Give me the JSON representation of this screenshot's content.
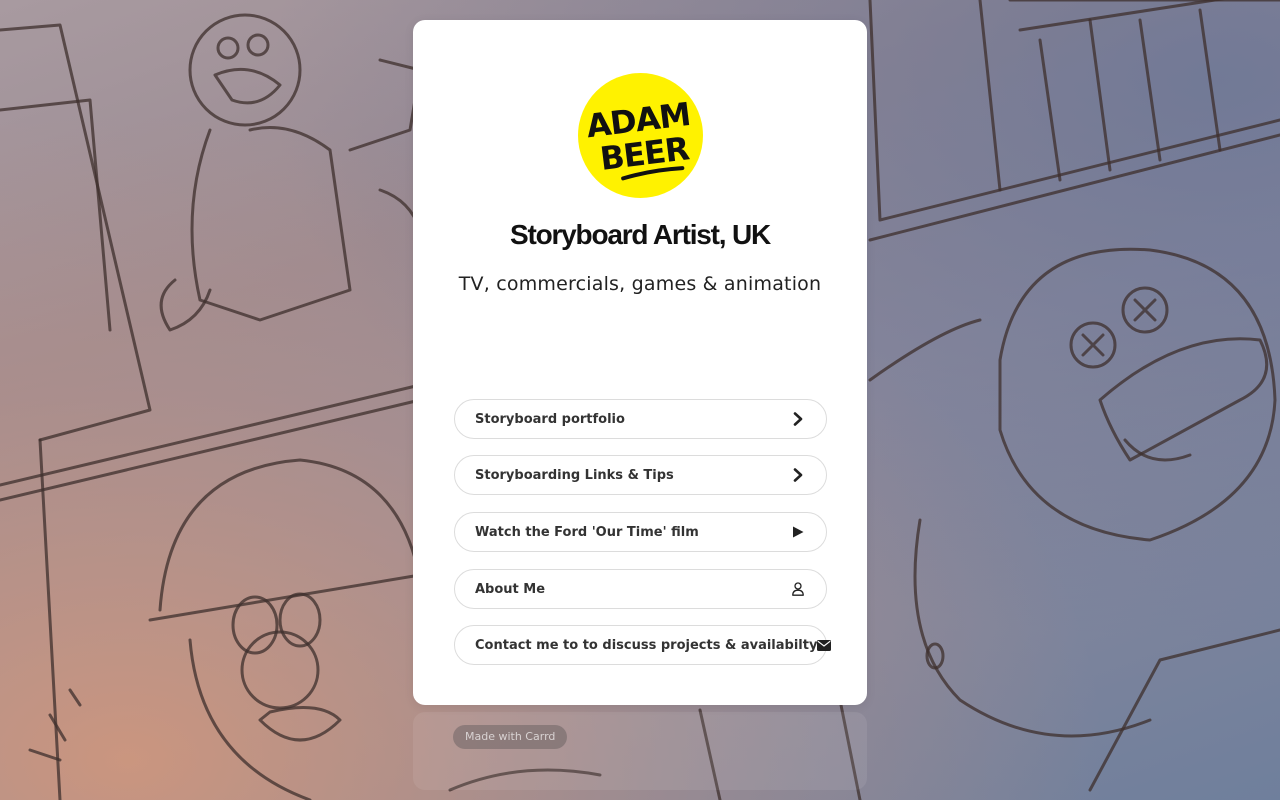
{
  "logo": {
    "line1": "ADAM",
    "line2": "BEER",
    "color": "#fff200"
  },
  "header": {
    "title": "Storyboard Artist, UK",
    "subtitle": "TV, commercials, games & animation"
  },
  "links": [
    {
      "label": "Storyboard portfolio",
      "icon": "chevron-right-icon"
    },
    {
      "label": "Storyboarding Links & Tips",
      "icon": "chevron-right-icon"
    },
    {
      "label": "Watch the Ford 'Our Time' film",
      "icon": "play-icon"
    },
    {
      "label": "About Me",
      "icon": "user-icon"
    },
    {
      "label": "Contact me to to discuss projects & availabilty",
      "icon": "envelope-icon"
    }
  ],
  "footer": {
    "made_with": "Made with Carrd"
  },
  "colors": {
    "card": "#ffffff",
    "text": "#111111",
    "link_text": "#333333",
    "link_border": "#dcdcdc"
  }
}
